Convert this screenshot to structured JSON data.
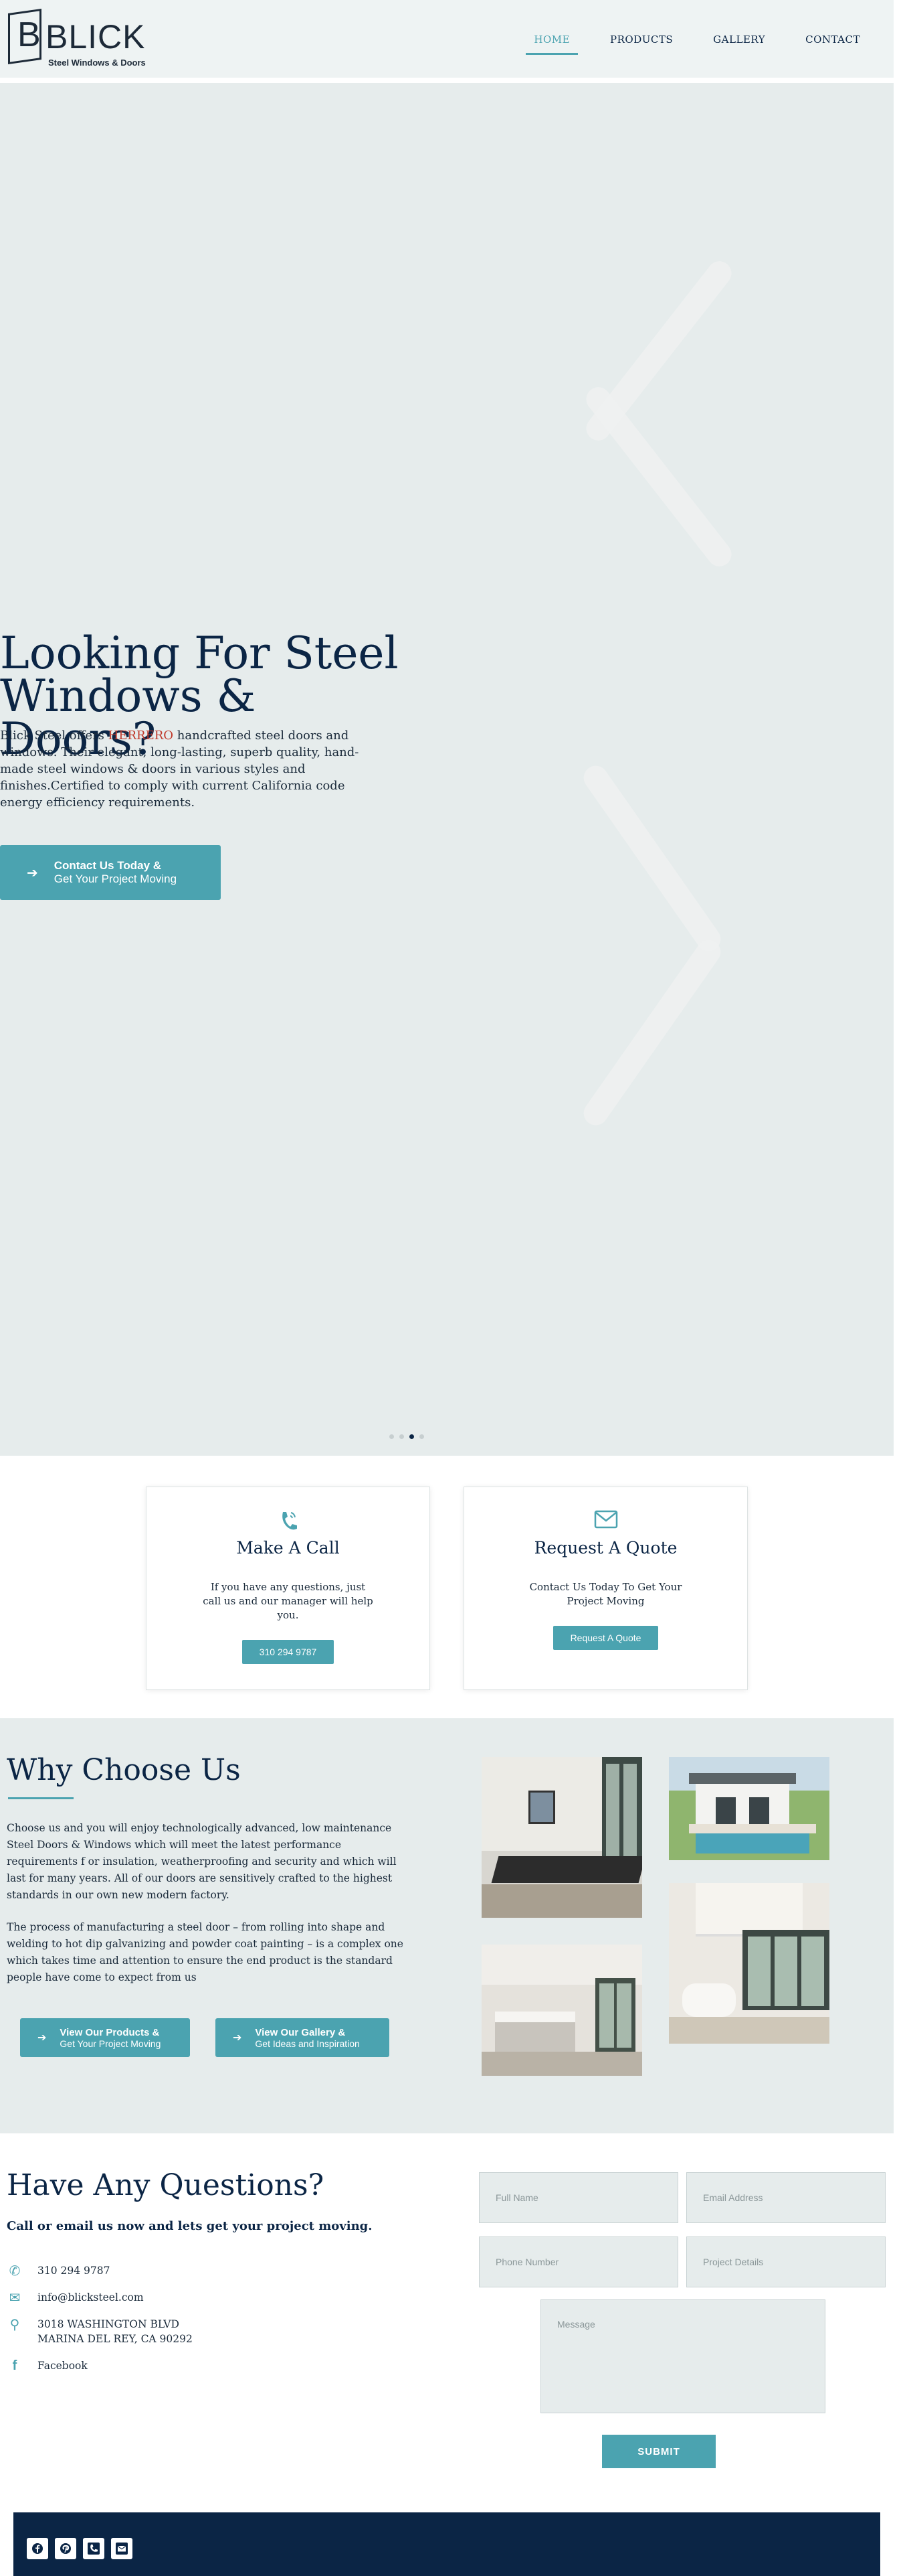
{
  "header": {
    "logo_letter": "B",
    "logo_word": "BLICK",
    "logo_tagline": "Steel Windows & Doors",
    "nav": [
      {
        "label": "HOME",
        "active": true
      },
      {
        "label": "PRODUCTS",
        "active": false
      },
      {
        "label": "GALLERY",
        "active": false
      },
      {
        "label": "CONTACT",
        "active": false
      }
    ]
  },
  "hero": {
    "title": "Looking For Steel Windows & Doors?",
    "text_before": "Blick Steel offers ",
    "brand": "HERRERO",
    "text_after": " handcrafted steel doors and windows. Their elegant, long-lasting, superb quality, hand-made steel windows & doors in various styles and finishes.Certified to comply with current California code energy efficiency requirements.",
    "button_line1": "Contact Us Today &",
    "button_line2": "Get Your Project Moving",
    "prev_icon": "chevron-left-icon",
    "next_icon": "chevron-right-icon",
    "slides": 4,
    "active_slide": 3
  },
  "cards": [
    {
      "icon": "phone-icon",
      "title": "Make A Call",
      "text": "If you have any questions, just call us and our manager will help you.",
      "button": "310 294 9787"
    },
    {
      "icon": "envelope-icon",
      "title": "Request A Quote",
      "text": "Contact Us Today To Get Your Project Moving",
      "button": "Request A Quote"
    }
  ],
  "why": {
    "title": "Why Choose Us",
    "p1": "Choose us and you will enjoy technologically advanced, low maintenance Steel Doors & Windows which will meet the latest performance requirements f or insulation, weatherproofing and security and which will last for many years. All of our doors are sensitively crafted to the highest standards in our own new modern factory.",
    "p2": "The process of manufacturing a steel door – from rolling into shape and welding to hot dip galvanizing and powder coat painting – is a complex one which takes time and attention to ensure the end product is the standard people have come to expect from us",
    "btn1_line1": "View Our Products &",
    "btn1_line2": "Get Your Project Moving",
    "btn2_line1": "View Our Gallery &",
    "btn2_line2": "Get Ideas and Inspiration"
  },
  "contact": {
    "title": "Have Any Questions?",
    "subtitle": "Call or email us now and lets get your project moving.",
    "phone": "310 294 9787",
    "email": "info@blicksteel.com",
    "address1": "3018 WASHINGTON BLVD",
    "address2": "MARINA DEL REY, CA 90292",
    "facebook": "Facebook",
    "form": {
      "full_name": "Full Name",
      "email": "Email Address",
      "phone": "Phone Number",
      "details": "Project Details",
      "message": "Message",
      "submit": "SUBMIT"
    }
  },
  "footer": {
    "icons": [
      "facebook-icon",
      "pinterest-icon",
      "phone-icon",
      "envelope-icon"
    ]
  },
  "colors": {
    "accent": "#4ba3b0",
    "navy": "#0b2545",
    "hero_bg": "#e6ecec"
  }
}
